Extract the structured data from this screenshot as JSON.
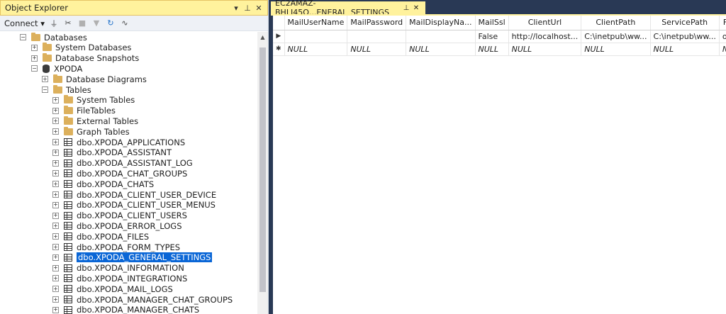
{
  "object_explorer": {
    "title": "Object Explorer",
    "title_buttons": [
      "▾",
      "⊥",
      "✕"
    ],
    "toolbar": {
      "connect_label": "Connect ▾"
    },
    "tree": [
      {
        "label": "Databases",
        "icon": "folder-icon",
        "expander": "−",
        "selected": false
      },
      {
        "label": "System Databases",
        "icon": "folder-icon",
        "expander": "+",
        "selected": false
      },
      {
        "label": "Database Snapshots",
        "icon": "folder-icon",
        "expander": "+",
        "selected": false
      },
      {
        "label": "XPODA",
        "icon": "database-icon",
        "expander": "−",
        "selected": false
      },
      {
        "label": "Database Diagrams",
        "icon": "folder-icon",
        "expander": "+",
        "selected": false
      },
      {
        "label": "Tables",
        "icon": "folder-icon",
        "expander": "−",
        "selected": false
      },
      {
        "label": "System Tables",
        "icon": "folder-icon",
        "expander": "+",
        "selected": false
      },
      {
        "label": "FileTables",
        "icon": "folder-icon",
        "expander": "+",
        "selected": false
      },
      {
        "label": "External Tables",
        "icon": "folder-icon",
        "expander": "+",
        "selected": false
      },
      {
        "label": "Graph Tables",
        "icon": "folder-icon",
        "expander": "+",
        "selected": false
      },
      {
        "label": "dbo.XPODA_APPLICATIONS",
        "icon": "table-icon",
        "expander": "+",
        "selected": false
      },
      {
        "label": "dbo.XPODA_ASSISTANT",
        "icon": "table-icon",
        "expander": "+",
        "selected": false
      },
      {
        "label": "dbo.XPODA_ASSISTANT_LOG",
        "icon": "table-icon",
        "expander": "+",
        "selected": false
      },
      {
        "label": "dbo.XPODA_CHAT_GROUPS",
        "icon": "table-icon",
        "expander": "+",
        "selected": false
      },
      {
        "label": "dbo.XPODA_CHATS",
        "icon": "table-icon",
        "expander": "+",
        "selected": false
      },
      {
        "label": "dbo.XPODA_CLIENT_USER_DEVICE",
        "icon": "table-icon",
        "expander": "+",
        "selected": false
      },
      {
        "label": "dbo.XPODA_CLIENT_USER_MENUS",
        "icon": "table-icon",
        "expander": "+",
        "selected": false
      },
      {
        "label": "dbo.XPODA_CLIENT_USERS",
        "icon": "table-icon",
        "expander": "+",
        "selected": false
      },
      {
        "label": "dbo.XPODA_ERROR_LOGS",
        "icon": "table-icon",
        "expander": "+",
        "selected": false
      },
      {
        "label": "dbo.XPODA_FILES",
        "icon": "table-icon",
        "expander": "+",
        "selected": false
      },
      {
        "label": "dbo.XPODA_FORM_TYPES",
        "icon": "table-icon",
        "expander": "+",
        "selected": false
      },
      {
        "label": "dbo.XPODA_GENERAL_SETTINGS",
        "icon": "table-icon",
        "expander": "+",
        "selected": true
      },
      {
        "label": "dbo.XPODA_INFORMATION",
        "icon": "table-icon",
        "expander": "+",
        "selected": false
      },
      {
        "label": "dbo.XPODA_INTEGRATIONS",
        "icon": "table-icon",
        "expander": "+",
        "selected": false
      },
      {
        "label": "dbo.XPODA_MAIL_LOGS",
        "icon": "table-icon",
        "expander": "+",
        "selected": false
      },
      {
        "label": "dbo.XPODA_MANAGER_CHAT_GROUPS",
        "icon": "table-icon",
        "expander": "+",
        "selected": false
      },
      {
        "label": "dbo.XPODA_MANAGER_CHATS",
        "icon": "table-icon",
        "expander": "+",
        "selected": false
      }
    ]
  },
  "document": {
    "tab_title": "EC2AMAZ-BHLJ45Q...ENERAL_SETTINGS",
    "tab_buttons": [
      "⊥",
      "✕"
    ],
    "grid": {
      "columns": [
        "MailUserName",
        "MailPassword",
        "MailDisplayNa...",
        "MailSsl",
        "ClientUrl",
        "ClientPath",
        "ServicePath",
        "F"
      ],
      "rows": [
        {
          "marker": "▶",
          "cells": [
            "",
            "",
            "",
            "False",
            "http://localhost...",
            "C:\\inetpub\\ww...",
            "C:\\inetpub\\ww...",
            "o"
          ]
        },
        {
          "marker": "✱",
          "cells": [
            "NULL",
            "NULL",
            "NULL",
            "NULL",
            "NULL",
            "NULL",
            "NULL",
            "N"
          ]
        }
      ]
    }
  },
  "colors": {
    "selection": "#0a66d6",
    "title_bar": "#fff29d",
    "background": "#293955"
  }
}
